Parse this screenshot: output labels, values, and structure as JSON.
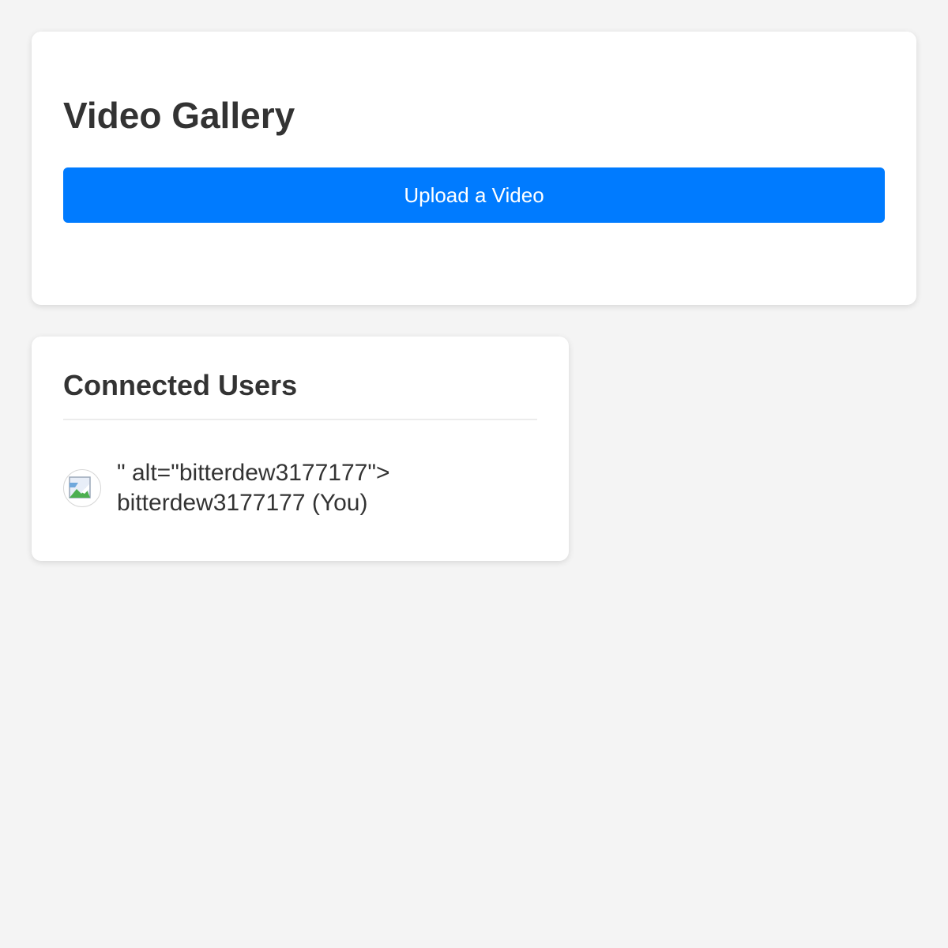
{
  "gallery": {
    "title": "Video Gallery",
    "upload_label": "Upload a Video"
  },
  "users": {
    "title": "Connected Users",
    "list": [
      {
        "line1": "\" alt=\"bitterdew3177177\">",
        "line2": "bitterdew3177177 (You)",
        "avatar_icon": "broken-image-icon"
      }
    ]
  },
  "colors": {
    "background": "#f4f4f4",
    "card": "#ffffff",
    "accent": "#007bff",
    "text": "#333333"
  }
}
